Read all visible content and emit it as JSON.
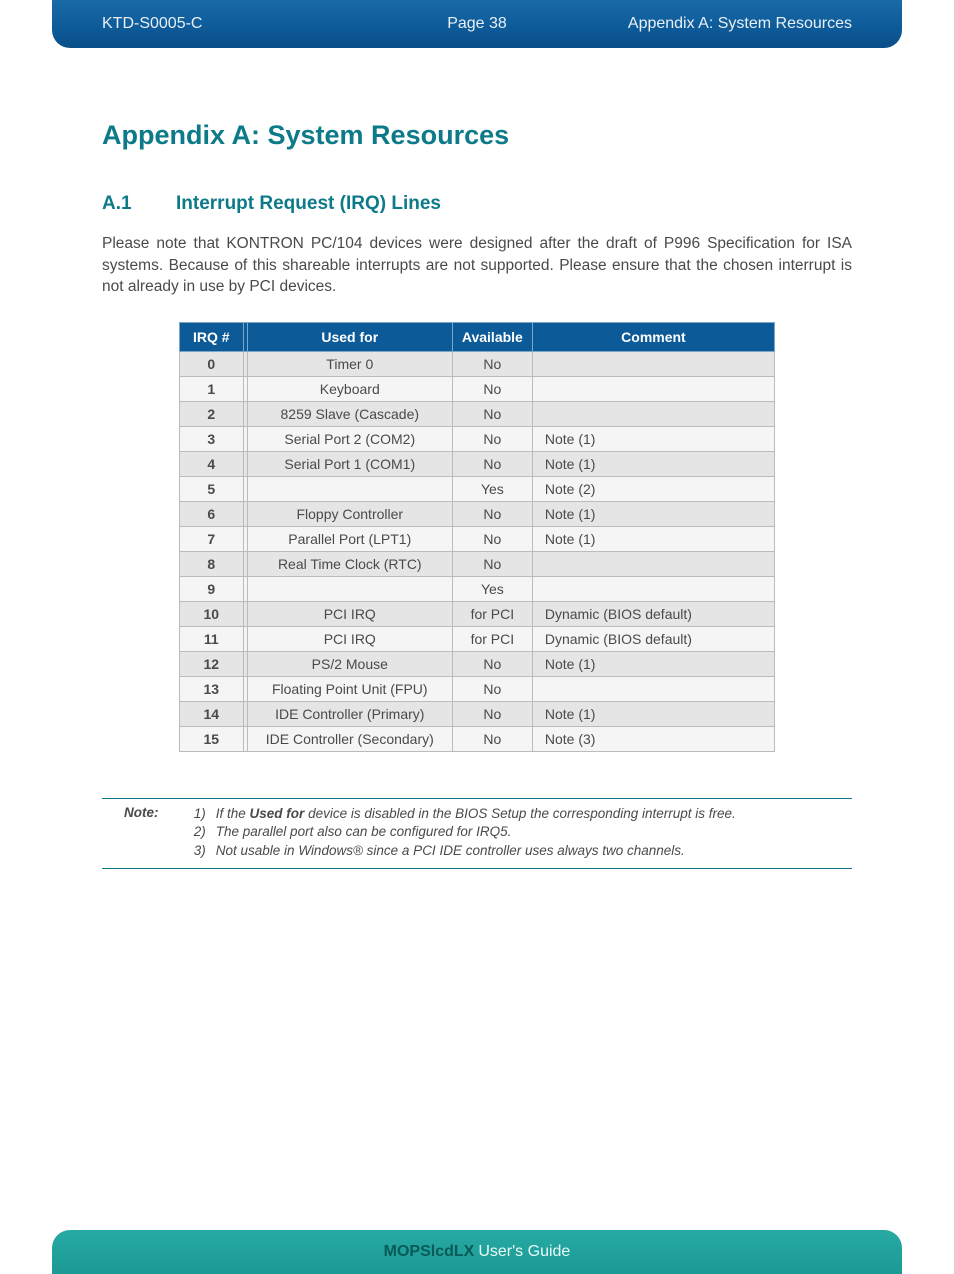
{
  "header": {
    "doc_code": "KTD-S0005-C",
    "page": "Page 38",
    "section": "Appendix A: System Resources"
  },
  "title": "Appendix A: System Resources",
  "section": {
    "num": "A.1",
    "name": "Interrupt Request (IRQ) Lines"
  },
  "intro": "Please note that KONTRON PC/104 devices were designed after the draft of P996 Specification for ISA systems. Because of this shareable interrupts are not supported. Please ensure that the chosen interrupt is not already in use by PCI devices.",
  "table": {
    "headers": {
      "irq": "IRQ #",
      "used": "Used for",
      "avail": "Available",
      "comment": "Comment"
    },
    "rows": [
      {
        "irq": "0",
        "used": "Timer 0",
        "avail": "No",
        "comment": ""
      },
      {
        "irq": "1",
        "used": "Keyboard",
        "avail": "No",
        "comment": ""
      },
      {
        "irq": "2",
        "used": "8259 Slave (Cascade)",
        "avail": "No",
        "comment": ""
      },
      {
        "irq": "3",
        "used": "Serial Port 2 (COM2)",
        "avail": "No",
        "comment": "Note (1)"
      },
      {
        "irq": "4",
        "used": "Serial Port 1 (COM1)",
        "avail": "No",
        "comment": "Note (1)"
      },
      {
        "irq": "5",
        "used": "",
        "avail": "Yes",
        "comment": "Note (2)"
      },
      {
        "irq": "6",
        "used": "Floppy Controller",
        "avail": "No",
        "comment": "Note (1)"
      },
      {
        "irq": "7",
        "used": "Parallel Port  (LPT1)",
        "avail": "No",
        "comment": "Note (1)"
      },
      {
        "irq": "8",
        "used": "Real Time Clock (RTC)",
        "avail": "No",
        "comment": ""
      },
      {
        "irq": "9",
        "used": "",
        "avail": "Yes",
        "comment": ""
      },
      {
        "irq": "10",
        "used": "PCI IRQ",
        "avail": "for PCI",
        "comment": "Dynamic (BIOS default)"
      },
      {
        "irq": "11",
        "used": "PCI IRQ",
        "avail": "for PCI",
        "comment": "Dynamic (BIOS default)"
      },
      {
        "irq": "12",
        "used": "PS/2 Mouse",
        "avail": "No",
        "comment": "Note (1)"
      },
      {
        "irq": "13",
        "used": "Floating Point Unit (FPU)",
        "avail": "No",
        "comment": ""
      },
      {
        "irq": "14",
        "used": "IDE Controller (Primary)",
        "avail": "No",
        "comment": "Note (1)"
      },
      {
        "irq": "15",
        "used": "IDE Controller (Secondary)",
        "avail": "No",
        "comment": "Note (3)"
      }
    ]
  },
  "notes": {
    "label": "Note:",
    "items": [
      {
        "n": "1)",
        "pre": "If the ",
        "bold": "Used for",
        "post": " device is disabled in the BIOS Setup the corresponding interrupt is free."
      },
      {
        "n": "2)",
        "pre": "The parallel port also can be configured for IRQ5.",
        "bold": "",
        "post": ""
      },
      {
        "n": "3)",
        "pre": "Not usable in Windows® since a PCI IDE controller uses always two channels.",
        "bold": "",
        "post": ""
      }
    ]
  },
  "footer": {
    "bold": "MOPSlcdLX",
    "rest": " User's Guide"
  }
}
